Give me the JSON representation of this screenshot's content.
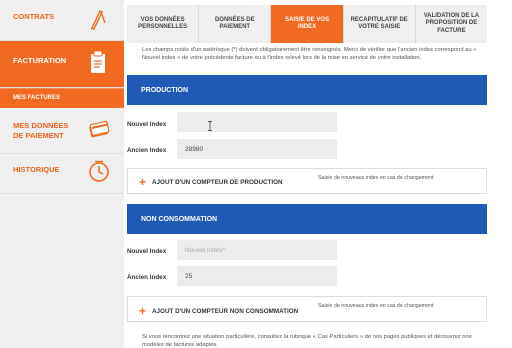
{
  "sidebar": {
    "contrats": {
      "label": "CONTRATS",
      "icon": "pen-icon"
    },
    "facturation": {
      "label": "FACTURATION",
      "icon": "bill-icon"
    },
    "mes_factures": {
      "label": "MES FACTURES"
    },
    "paiement": {
      "label_line1": "MES DONNÉES",
      "label_line2": "DE PAIEMENT",
      "icon": "card-icon"
    },
    "historique": {
      "label": "HISTORIQUE",
      "icon": "clock-icon"
    }
  },
  "steps": [
    {
      "line1": "VOS DONNÉES",
      "line2": "PERSONNELLES",
      "line3": ""
    },
    {
      "line1": "DONNÉES DE",
      "line2": "PAIEMENT",
      "line3": ""
    },
    {
      "line1": "SAISIE DE VOS INDEX",
      "line2": "",
      "line3": ""
    },
    {
      "line1": "RECAPITULATIF DE",
      "line2": "VOTRE SAISIE",
      "line3": ""
    },
    {
      "line1": "VALIDATION DE LA",
      "line2": "PROPOSITION DE",
      "line3": "FACTURE"
    }
  ],
  "intro": "Les champs notés d'un astérisque (*) doivent obligatoirement être renseignés. Merci de vérifier que l'ancien index correspond au « Nouvel index » de votre précédente facture ou à l'index relevé lors de la mise en service de votre installation.",
  "production": {
    "title": "PRODUCTION",
    "nouvel_label": "Nouvel Index",
    "nouvel_value": "",
    "ancien_label": "Ancien Index",
    "ancien_value": "28980",
    "add_label": "AJOUT D'UN COMPTEUR DE PRODUCTION",
    "add_hint": "Saisie de nouveaux index en cas de changement"
  },
  "non_consommation": {
    "title": "NON CONSOMMATION",
    "nouvel_label": "Nouvel Index",
    "nouvel_placeholder": "Nouvel index*",
    "ancien_label": "Ancien Index",
    "ancien_value": "25",
    "add_label": "AJOUT D'UN COMPTEUR NON CONSOMMATION",
    "add_hint": "Saisie de nouveaux index en cas de changement"
  },
  "footer_note": "Si vous rencontrez une situation particulière, consultez la rubrique « Cas Particuliers » de nos pages publiques et découvrez nos modèles de factures adaptés.",
  "colors": {
    "accent": "#f26a21",
    "section": "#2159b6",
    "sidebar": "#efefef"
  }
}
